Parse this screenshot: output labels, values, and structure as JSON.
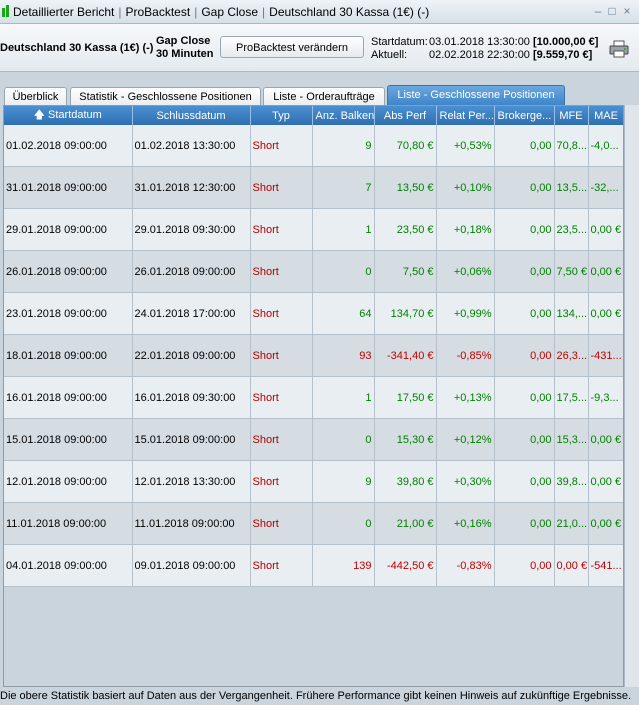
{
  "window": {
    "title_parts": [
      "Detaillierter Bericht",
      "ProBacktest",
      "Gap Close",
      "Deutschland 30 Kassa (1€) (-)"
    ],
    "controls": [
      "–",
      "□",
      "×"
    ]
  },
  "header": {
    "instrument": "Deutschland 30 Kassa (1€) (-)",
    "strategy_name": "Gap Close",
    "timeframe": "30 Minuten",
    "change_button": "ProBacktest verändern",
    "start_label": "Startdatum:",
    "start_value": "03.01.2018 13:30:00",
    "start_capital": "[10.000,00 €]",
    "current_label": "Aktuell:",
    "current_value": "02.02.2018 22:30:00",
    "current_capital": "[9.559,70 €]"
  },
  "tabs": [
    {
      "label": "Überblick",
      "active": false
    },
    {
      "label": "Statistik - Geschlossene Positionen",
      "active": false
    },
    {
      "label": "Liste - Orderaufträge",
      "active": false
    },
    {
      "label": "Liste - Geschlossene Positionen",
      "active": true
    }
  ],
  "table": {
    "columns": [
      "Startdatum",
      "Schlussdatum",
      "Typ",
      "Anz. Balken",
      "Abs Perf",
      "Relat Per...",
      "Brokerge...",
      "MFE",
      "MAE"
    ],
    "rows": [
      {
        "start": "01.02.2018 09:00:00",
        "end": "01.02.2018 13:30:00",
        "type": "Short",
        "bars": "9",
        "abs": "70,80 €",
        "rel": "+0,53%",
        "broker": "0,00",
        "mfe": "70,8...",
        "mae": "-4,0...",
        "positive": true
      },
      {
        "start": "31.01.2018 09:00:00",
        "end": "31.01.2018 12:30:00",
        "type": "Short",
        "bars": "7",
        "abs": "13,50 €",
        "rel": "+0,10%",
        "broker": "0,00",
        "mfe": "13,5...",
        "mae": "-32,...",
        "positive": true
      },
      {
        "start": "29.01.2018 09:00:00",
        "end": "29.01.2018 09:30:00",
        "type": "Short",
        "bars": "1",
        "abs": "23,50 €",
        "rel": "+0,18%",
        "broker": "0,00",
        "mfe": "23,5...",
        "mae": "0,00 €",
        "positive": true
      },
      {
        "start": "26.01.2018 09:00:00",
        "end": "26.01.2018 09:00:00",
        "type": "Short",
        "bars": "0",
        "abs": "7,50 €",
        "rel": "+0,06%",
        "broker": "0,00",
        "mfe": "7,50 €",
        "mae": "0,00 €",
        "positive": true
      },
      {
        "start": "23.01.2018 09:00:00",
        "end": "24.01.2018 17:00:00",
        "type": "Short",
        "bars": "64",
        "abs": "134,70 €",
        "rel": "+0,99%",
        "broker": "0,00",
        "mfe": "134,...",
        "mae": "0,00 €",
        "positive": true
      },
      {
        "start": "18.01.2018 09:00:00",
        "end": "22.01.2018 09:00:00",
        "type": "Short",
        "bars": "93",
        "abs": "-341,40 €",
        "rel": "-0,85%",
        "broker": "0,00",
        "mfe": "26,3...",
        "mae": "-431...",
        "positive": false
      },
      {
        "start": "16.01.2018 09:00:00",
        "end": "16.01.2018 09:30:00",
        "type": "Short",
        "bars": "1",
        "abs": "17,50 €",
        "rel": "+0,13%",
        "broker": "0,00",
        "mfe": "17,5...",
        "mae": "-9,3...",
        "positive": true
      },
      {
        "start": "15.01.2018 09:00:00",
        "end": "15.01.2018 09:00:00",
        "type": "Short",
        "bars": "0",
        "abs": "15,30 €",
        "rel": "+0,12%",
        "broker": "0,00",
        "mfe": "15,3...",
        "mae": "0,00 €",
        "positive": true
      },
      {
        "start": "12.01.2018 09:00:00",
        "end": "12.01.2018 13:30:00",
        "type": "Short",
        "bars": "9",
        "abs": "39,80 €",
        "rel": "+0,30%",
        "broker": "0,00",
        "mfe": "39,8...",
        "mae": "0,00 €",
        "positive": true
      },
      {
        "start": "11.01.2018 09:00:00",
        "end": "11.01.2018 09:00:00",
        "type": "Short",
        "bars": "0",
        "abs": "21,00 €",
        "rel": "+0,16%",
        "broker": "0,00",
        "mfe": "21,0...",
        "mae": "0,00 €",
        "positive": true
      },
      {
        "start": "04.01.2018 09:00:00",
        "end": "09.01.2018 09:00:00",
        "type": "Short",
        "bars": "139",
        "abs": "-442,50 €",
        "rel": "-0,83%",
        "broker": "0,00",
        "mfe": "0,00 €",
        "mae": "-541...",
        "positive": false
      }
    ]
  },
  "footer": {
    "disclaimer": "Die obere Statistik basiert auf Daten aus der Vergangenheit. Frühere Performance gibt keinen Hinweis auf zukünftige Ergebnisse."
  },
  "colors": {
    "positive": "#008000",
    "negative": "#c00000",
    "type_short": "#b00000",
    "header_blue": "#3d83c7"
  }
}
